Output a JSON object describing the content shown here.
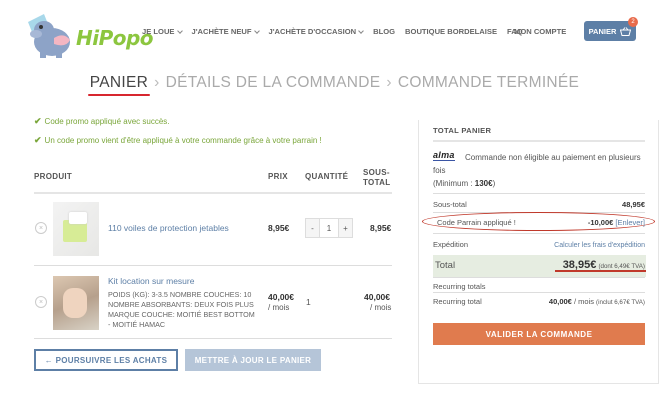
{
  "header": {
    "logo_text": "HiPopo",
    "nav": [
      "JE LOUE",
      "J'ACHÈTE NEUF",
      "J'ACHÈTE D'OCCASION",
      "BLOG",
      "BOUTIQUE BORDELAISE",
      "FAQ"
    ],
    "account": "MON COMPTE",
    "cart_label": "PANIER",
    "cart_count": "2"
  },
  "steps": {
    "step1": "PANIER",
    "step2": "DÉTAILS DE LA COMMANDE",
    "step3": "COMMANDE TERMINÉE",
    "separator": "›"
  },
  "messages": [
    "Code promo appliqué avec succès.",
    "Un code promo vient d'être appliqué à votre commande grâce à votre parrain !"
  ],
  "table": {
    "col_product": "PRODUIT",
    "col_price": "PRIX",
    "col_qty": "QUANTITÉ",
    "col_subtotal_line1": "SOUS-",
    "col_subtotal_line2": "TOTAL",
    "items": [
      {
        "name": "110 voiles de protection jetables",
        "price": "8,95€",
        "qty": "1",
        "subtotal": "8,95€"
      },
      {
        "name": "Kit location sur mesure",
        "meta": "POIDS (KG): 3-3.5   NOMBRE COUCHES: 10   NOMBRE ABSORBANTS: DEUX FOIS PLUS   MARQUE COUCHE: MOITIÉ BEST BOTTOM - MOITIÉ HAMAC",
        "price": "40,00€",
        "price_unit": "/ mois",
        "qty": "1",
        "subtotal": "40,00€",
        "subtotal_unit": "/ mois"
      }
    ]
  },
  "buttons": {
    "continue": "← POURSUIVRE LES ACHATS",
    "update": "METTRE À JOUR LE PANIER",
    "validate": "VALIDER LA COMMANDE"
  },
  "totals": {
    "title": "TOTAL PANIER",
    "alma_logo": "alma",
    "alma_text": "Commande non éligible au paiement en plusieurs fois",
    "alma_min_label": "(Minimum : ",
    "alma_min_value": "130€",
    "alma_min_end": ")",
    "subtotal_label": "Sous-total",
    "subtotal_value": "48,95€",
    "coupon_label": "Code Parrain appliqué !",
    "coupon_value": "-10,00€",
    "coupon_remove": "[Enlever]",
    "shipping_label": "Expédition",
    "shipping_link": "Calculer les frais d'expédition",
    "total_label": "Total",
    "total_value": "38,95€",
    "total_tax": "(dont 6,49€ TVA)",
    "recurring_totals": "Recurring totals",
    "recurring_total_label": "Recurring total",
    "recurring_total_value": "40,00€",
    "recurring_total_unit": " / mois",
    "recurring_total_tax": "(inclut 6,67€ TVA)"
  }
}
